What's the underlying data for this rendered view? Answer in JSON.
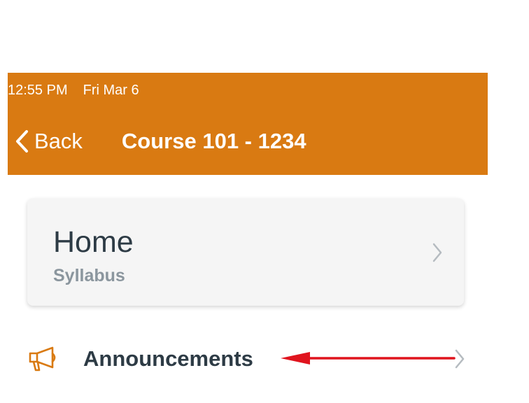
{
  "status_bar": {
    "time": "12:55 PM",
    "date": "Fri Mar 6"
  },
  "nav": {
    "back_label": "Back",
    "title": "Course 101 - 1234"
  },
  "home_card": {
    "title": "Home",
    "subtitle": "Syllabus"
  },
  "announcements": {
    "label": "Announcements"
  },
  "colors": {
    "header_bg": "#D97A12",
    "card_bg": "#F5F5F5",
    "text_dark": "#2D3B45",
    "text_muted": "#8B969E",
    "annotation_arrow": "#E0141E"
  },
  "icons": {
    "back": "chevron-left-icon",
    "home_chevron": "chevron-right-icon",
    "announcements": "megaphone-icon",
    "row_chevron": "chevron-right-icon",
    "annotation": "red-arrow-icon"
  }
}
